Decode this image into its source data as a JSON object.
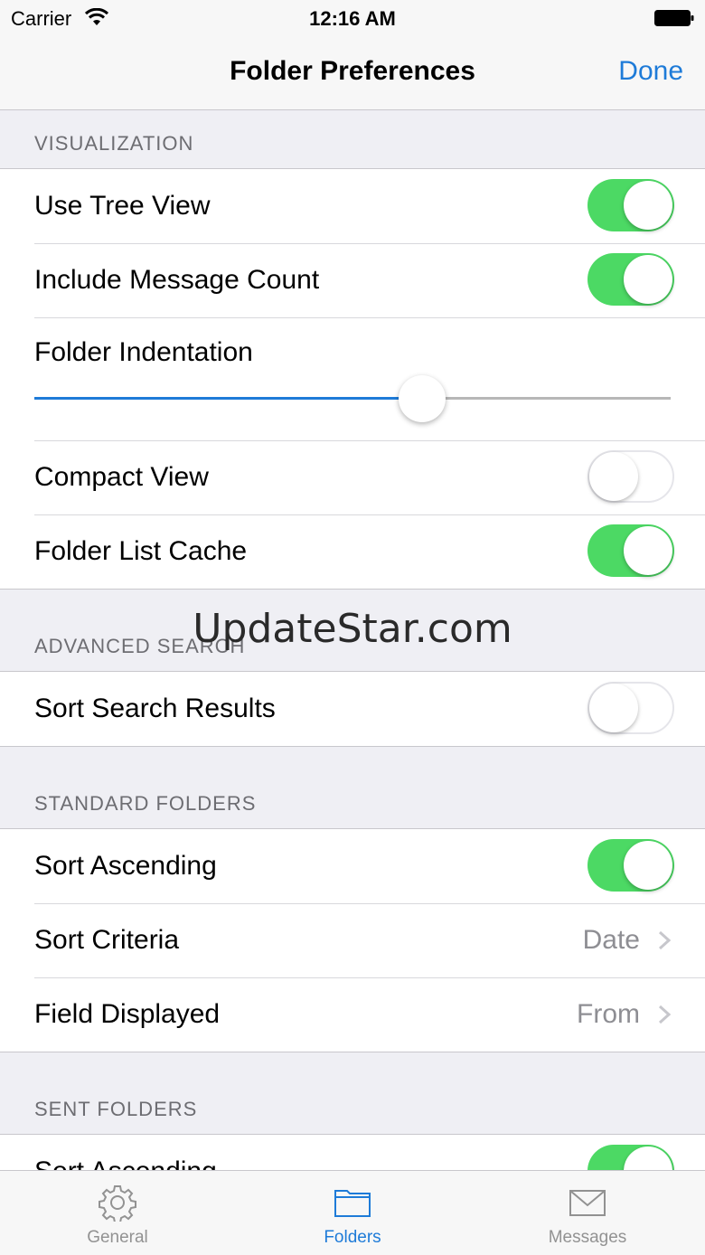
{
  "status_bar": {
    "carrier": "Carrier",
    "time": "12:16 AM"
  },
  "nav": {
    "title": "Folder Preferences",
    "done": "Done"
  },
  "sections": {
    "visualization": {
      "header": "VISUALIZATION",
      "use_tree_view": {
        "label": "Use Tree View",
        "on": true
      },
      "include_message_count": {
        "label": "Include Message Count",
        "on": true
      },
      "folder_indentation": {
        "label": "Folder Indentation",
        "value_fraction": 0.61
      },
      "compact_view": {
        "label": "Compact View",
        "on": false
      },
      "folder_list_cache": {
        "label": "Folder List Cache",
        "on": true
      }
    },
    "advanced_search": {
      "header": "ADVANCED SEARCH",
      "sort_search_results": {
        "label": "Sort Search Results",
        "on": false
      }
    },
    "standard_folders": {
      "header": "STANDARD FOLDERS",
      "sort_ascending": {
        "label": "Sort Ascending",
        "on": true
      },
      "sort_criteria": {
        "label": "Sort Criteria",
        "value": "Date"
      },
      "field_displayed": {
        "label": "Field Displayed",
        "value": "From"
      }
    },
    "sent_folders": {
      "header": "SENT FOLDERS",
      "sort_ascending": {
        "label": "Sort Ascending",
        "on": true
      }
    }
  },
  "watermark": "UpdateStar.com",
  "tabs": [
    {
      "label": "General",
      "icon": "gear-icon"
    },
    {
      "label": "Folders",
      "icon": "folder-icon"
    },
    {
      "label": "Messages",
      "icon": "envelope-icon"
    }
  ],
  "colors": {
    "accent": "#1e7bd8",
    "switch_on": "#4cd964",
    "inactive_tab": "#929292"
  }
}
